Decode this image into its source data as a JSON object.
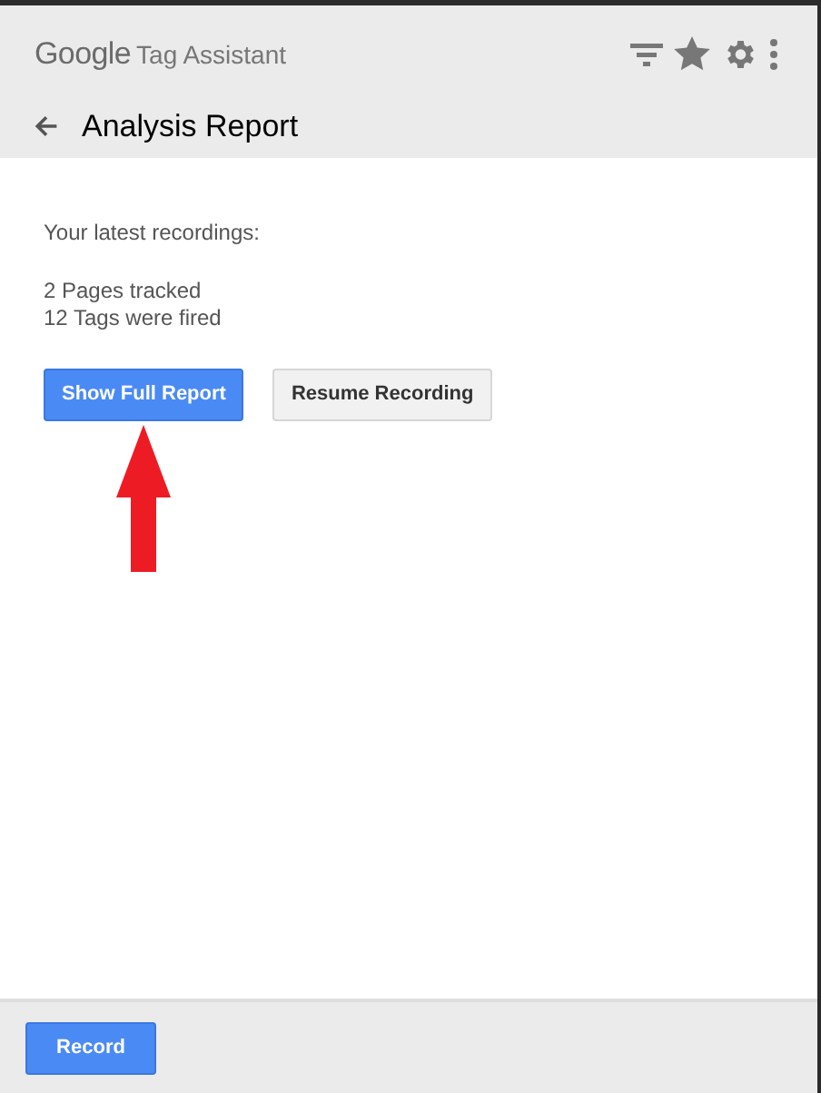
{
  "header": {
    "brand": "Google",
    "product": "Tag Assistant",
    "title": "Analysis Report"
  },
  "content": {
    "intro": "Your latest recordings:",
    "stats": [
      "2 Pages tracked",
      "12 Tags were fired"
    ],
    "buttons": [
      {
        "label": "Show Full Report",
        "kind": "primary"
      },
      {
        "label": "Resume Recording",
        "kind": "secondary"
      }
    ]
  },
  "footer": {
    "button": "Record"
  }
}
